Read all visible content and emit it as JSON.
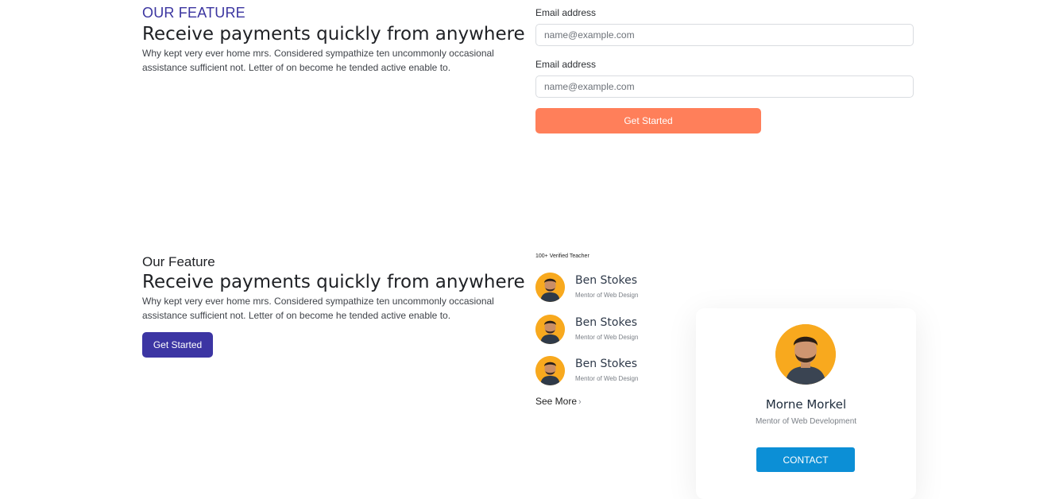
{
  "section1": {
    "eyebrow": "OUR FEATURE",
    "heading": "Receive payments quickly from anywhere",
    "paragraph": "Why kept very ever home mrs. Considered sympathize ten uncommonly occasional assistance sufficient not. Letter of on become he tended active enable to.",
    "form": {
      "field1_label": "Email address",
      "field1_placeholder": "name@example.com",
      "field2_label": "Email address",
      "field2_placeholder": "name@example.com",
      "submit_label": "Get Started"
    }
  },
  "section2": {
    "subtitle": "Our Feature",
    "heading": "Receive payments quickly from anywhere",
    "paragraph": "Why kept very ever home mrs. Considered sympathize ten uncommonly occasional assistance sufficient not. Letter of on become he tended active enable to.",
    "cta_label": "Get Started",
    "verified_label": "100+ Verified Teacher",
    "teachers": [
      {
        "name": "Ben Stokes",
        "role": "Mentor of Web Design"
      },
      {
        "name": "Ben Stokes",
        "role": "Mentor of Web Design"
      },
      {
        "name": "Ben Stokes",
        "role": "Mentor of Web Design"
      }
    ],
    "see_more_label": "See More",
    "see_more_icon": "arrow-right-icon",
    "card": {
      "name": "Morne Morkel",
      "role": "Mentor of Web Development",
      "contact_label": "CONTACT"
    }
  },
  "colors": {
    "brand_indigo": "#3c35a3",
    "accent_orange": "#ff7f5a",
    "avatar_yellow": "#f8a91e",
    "contact_blue": "#0c8fd6"
  }
}
